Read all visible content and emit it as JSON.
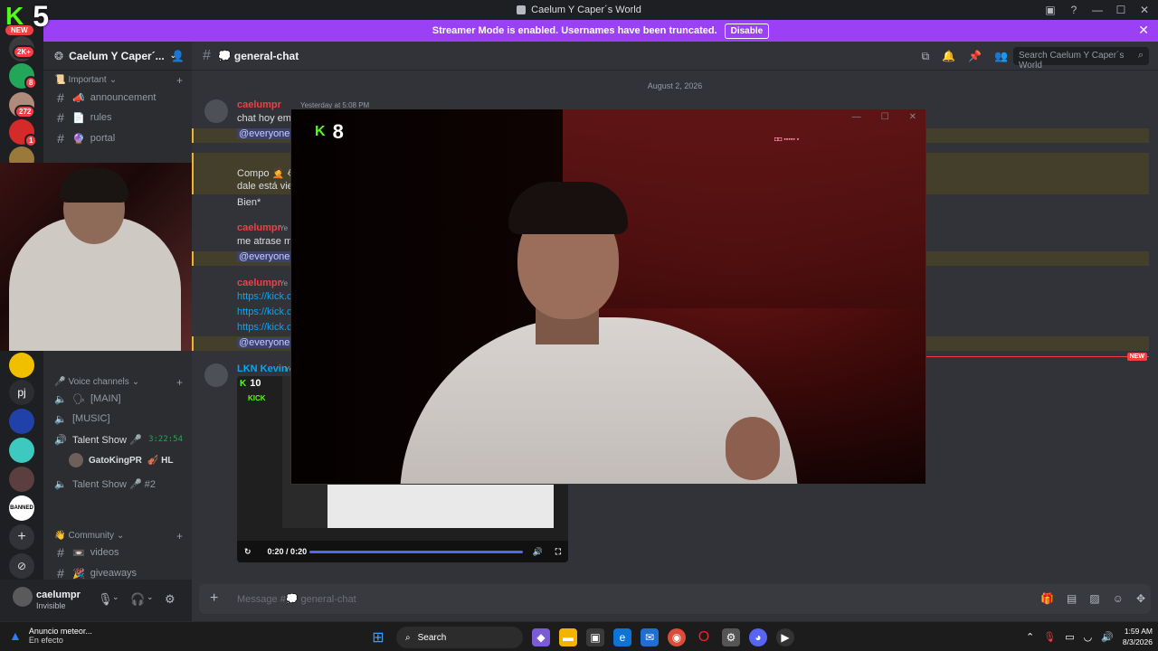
{
  "window": {
    "title": "Caelum Y Caper´s World",
    "controls": [
      "inbox-icon",
      "help-icon",
      "minimize-icon",
      "maximize-icon",
      "close-icon"
    ]
  },
  "overlay": {
    "kick_count_top": "5",
    "kick_count_popout": "8",
    "kick_count_embed": "10",
    "new_tag": "NEW"
  },
  "banner": {
    "text": "Streamer Mode is enabled. Usernames have been truncated.",
    "button": "Disable"
  },
  "rail": {
    "badges": [
      "2K+",
      "8",
      "272",
      "1"
    ],
    "pj_label": "pj",
    "banned_label": "BANNED"
  },
  "server": {
    "name": "Caelum Y Caper´...",
    "categories": {
      "important": "Important",
      "voice": "Voice channels",
      "community": "Community"
    },
    "channels": [
      {
        "name": "announcement",
        "emoji": "📣"
      },
      {
        "name": "rules",
        "emoji": "📄"
      },
      {
        "name": "portal",
        "emoji": "🔮"
      }
    ],
    "voice_channels": [
      {
        "name": "[MAIN]",
        "emoji": "🗣"
      },
      {
        "name": "[MUSIC]",
        "emoji": ""
      },
      {
        "name": "Talent Show 🎤",
        "duration": "3:22:54"
      },
      {
        "name": "Talent Show 🎤 #2",
        "duration": ""
      }
    ],
    "voice_user": {
      "name": "GatoKingPR",
      "tag": "🎻 HL"
    },
    "community_channels": [
      {
        "name": "videos",
        "emoji": "📼"
      },
      {
        "name": "giveaways",
        "emoji": "🎉"
      }
    ]
  },
  "user": {
    "name": "caelumpr",
    "status": "Invisible"
  },
  "channel": {
    "name": "general-chat",
    "emoji": "💭",
    "search_placeholder": "Search Caelum Y Caper´s World",
    "date_divider": "August 2, 2026",
    "new_badge": "NEW",
    "composer_placeholder": "Message #💭 general-chat"
  },
  "messages": [
    {
      "author": "caelumpr",
      "time": "Yesterday at 5:08 PM",
      "lines": [
        "chat hoy emp"
      ],
      "mention": "@everyone"
    },
    {
      "author": "",
      "time": "",
      "lines": [
        "Compo 🤦 😭",
        "dale está vier",
        "Bien*"
      ],
      "mention": ""
    },
    {
      "author": "caelumpr",
      "time": "Ye",
      "lines": [
        "me atrase mi"
      ],
      "mention": "@everyone"
    },
    {
      "author": "caelumpr",
      "time": "Ye",
      "links": [
        "https://kick.c",
        "https://kick.c",
        "https://kick.c"
      ],
      "mention": "@everyone"
    },
    {
      "author": "LKN Kevin",
      "time": "Ye",
      "lines": [],
      "mention": ""
    }
  ],
  "embed": {
    "kick_word": "KICK",
    "time": "0:20 / 0:20",
    "progress": 1.0
  },
  "taskbar": {
    "weather_title": "Anuncio meteor...",
    "weather_sub": "En efecto",
    "search": "Search",
    "time": "1:59 AM",
    "date": "8/3/2026"
  },
  "colors": {
    "banner": "#9b41f5",
    "mention_bg": "#443f2a",
    "kick_green": "#53fc18",
    "author_red": "#f23f43",
    "link": "#00a8fc"
  }
}
